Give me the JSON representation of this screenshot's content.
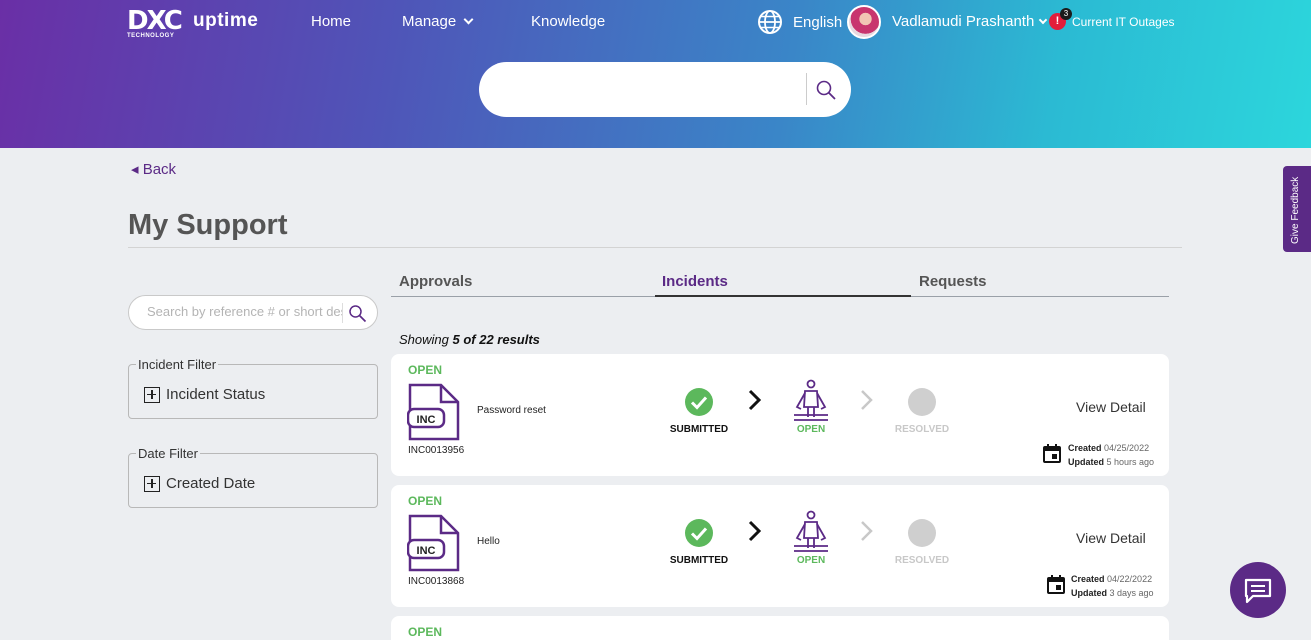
{
  "header": {
    "logo_mark": "DXC",
    "logo_sub": "TECHNOLOGY",
    "brand": "uptime",
    "nav": [
      {
        "label": "Home"
      },
      {
        "label": "Manage"
      },
      {
        "label": "Knowledge"
      }
    ],
    "language": "English",
    "user_name": "Vadlamudi Prashanth",
    "alert_icon": "!",
    "alert_count": "3",
    "outages_label": "Current IT Outages",
    "search_placeholder": ""
  },
  "back_label": "◂ Back",
  "page_title": "My Support",
  "filters": {
    "search_placeholder": "Search by reference # or short description",
    "incident_filter": {
      "legend": "Incident Filter",
      "item": "Incident Status"
    },
    "date_filter": {
      "legend": "Date Filter",
      "item": "Created Date"
    }
  },
  "tabs": [
    {
      "label": "Approvals",
      "active": false
    },
    {
      "label": "Incidents",
      "active": true
    },
    {
      "label": "Requests",
      "active": false
    }
  ],
  "results": {
    "prefix": "Showing ",
    "count_text": "5 of 22 results"
  },
  "incidents": [
    {
      "status": "OPEN",
      "doc_label": "INC",
      "number": "INC0013956",
      "description": "Password reset",
      "steps": [
        "SUBMITTED",
        "OPEN",
        "RESOLVED"
      ],
      "view_label": "View Detail",
      "created_label": "Created",
      "created_value": "04/25/2022",
      "updated_label": "Updated",
      "updated_value": "5 hours ago"
    },
    {
      "status": "OPEN",
      "doc_label": "INC",
      "number": "INC0013868",
      "description": "Hello",
      "steps": [
        "SUBMITTED",
        "OPEN",
        "RESOLVED"
      ],
      "view_label": "View Detail",
      "created_label": "Created",
      "created_value": "04/22/2022",
      "updated_label": "Updated",
      "updated_value": "3 days ago"
    },
    {
      "status": "OPEN"
    }
  ],
  "feedback_label": "Give Feedback",
  "colors": {
    "accent": "#5b2a86",
    "status_open": "#5cb85c",
    "inactive": "#c8c8c8"
  },
  "icons": [
    "globe-icon",
    "search-icon",
    "alert-icon",
    "document-icon",
    "check-circle-icon",
    "chevron-right-icon",
    "person-icon",
    "circle-icon",
    "calendar-icon",
    "chat-icon"
  ]
}
